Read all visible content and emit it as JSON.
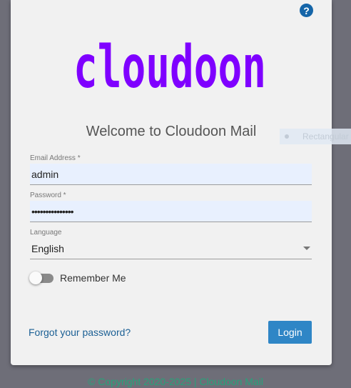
{
  "help": {
    "icon": "question-circle-icon",
    "glyph": "?"
  },
  "logo": {
    "text": "cloudoon",
    "color": "#7f00ff"
  },
  "welcome": "Welcome to Cloudoon Mail",
  "email": {
    "label": "Email Address *",
    "value": "admin"
  },
  "password": {
    "label": "Password *",
    "value": "•••••••••••••••"
  },
  "language": {
    "label": "Language",
    "value": "English"
  },
  "remember": {
    "label": "Remember Me",
    "checked": false
  },
  "forgot": "Forgot your password?",
  "login": "Login",
  "overlay": {
    "label": "Rectangular"
  },
  "footer": "© Copyright 2020-2025 | Cloudoon Mail",
  "colors": {
    "primary": "#2f86c6",
    "link": "#1a5f94",
    "footer": "#27a37a",
    "background": "#6e6e78"
  }
}
